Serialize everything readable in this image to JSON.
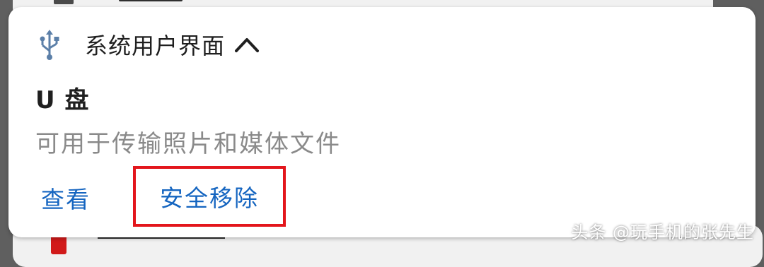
{
  "notification": {
    "app_name": "系统用户界面",
    "title": "U 盘",
    "text": "可用于传输照片和媒体文件",
    "actions": {
      "view_label": "查看",
      "eject_label": "安全移除"
    }
  },
  "icons": {
    "app_icon": "usb-icon",
    "expand_icon": "chevron-up-icon"
  },
  "colors": {
    "accent": "#1565c0",
    "highlight_box": "#e3161c",
    "icon": "#5b7fa8"
  },
  "watermark": "头条 @玩手机的张先生"
}
